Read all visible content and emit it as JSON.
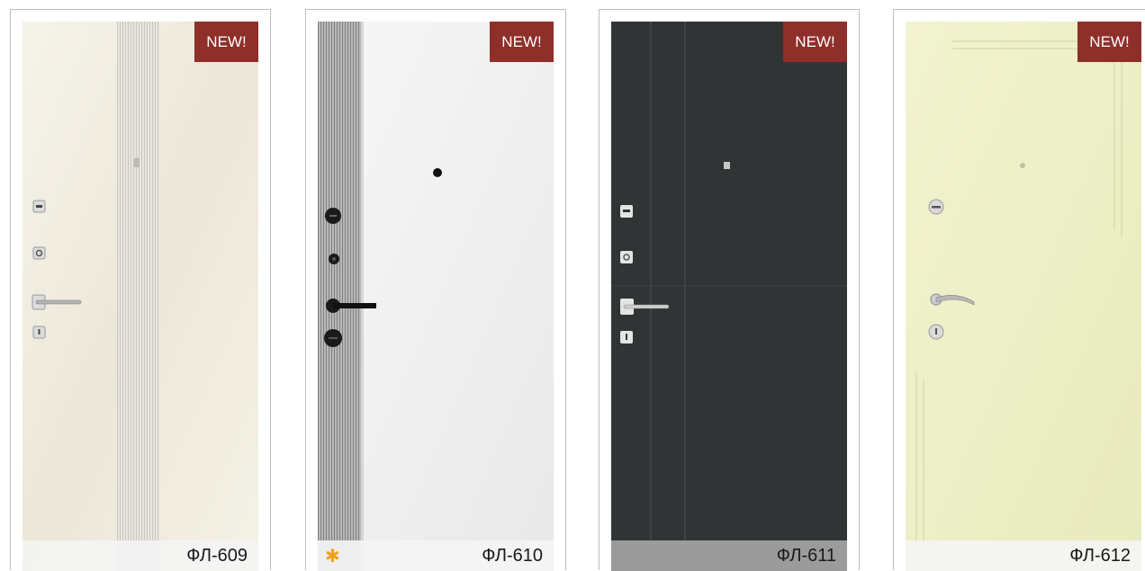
{
  "products": [
    {
      "model": "ФЛ-609",
      "badge": "NEW!"
    },
    {
      "model": "ФЛ-610",
      "badge": "NEW!",
      "mark": "✱"
    },
    {
      "model": "ФЛ-611",
      "badge": "NEW!"
    },
    {
      "model": "ФЛ-612",
      "badge": "NEW!"
    }
  ],
  "colors": {
    "badge": "#8f2f2a",
    "door_609": "#f1ede0",
    "door_610": "#f2f2f2",
    "door_611": "#2f3233",
    "door_612": "#eeefc4",
    "star": "#f0a020"
  }
}
